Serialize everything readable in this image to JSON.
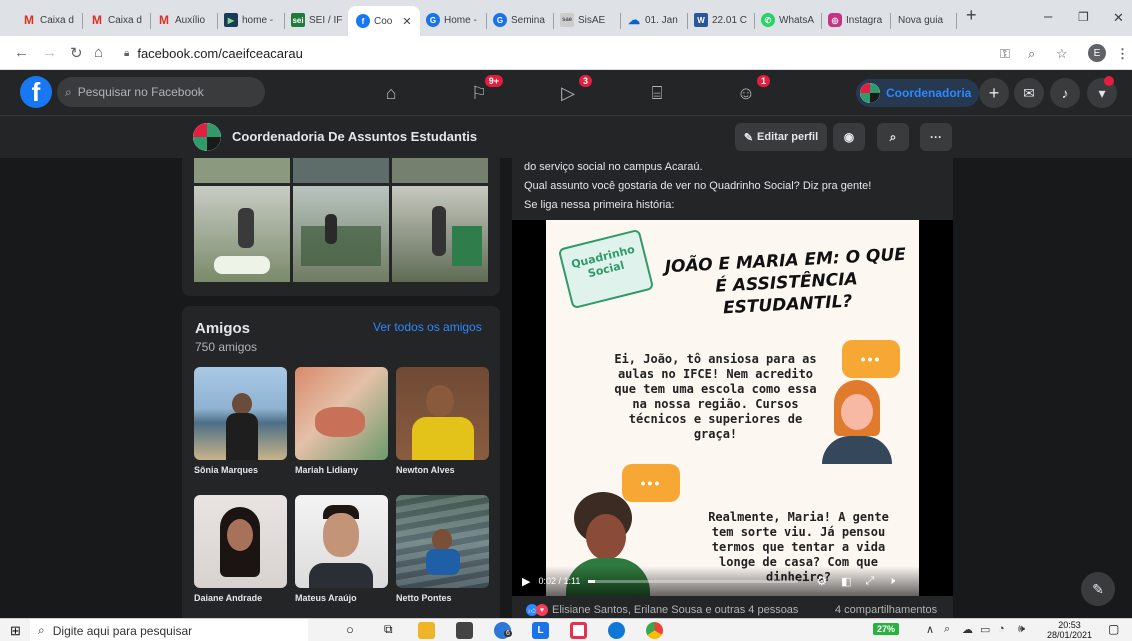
{
  "browser": {
    "tabs": [
      {
        "label": "Caixa d",
        "icon": "gmail-icon"
      },
      {
        "label": "Caixa d",
        "icon": "gmail-icon"
      },
      {
        "label": "Auxílio",
        "icon": "gmail-icon"
      },
      {
        "label": "home -",
        "icon": "video-icon"
      },
      {
        "label": "SEI / IF",
        "icon": "sei-icon"
      },
      {
        "label": "Coo",
        "icon": "facebook-icon"
      },
      {
        "label": "Home -",
        "icon": "google-icon"
      },
      {
        "label": "Semina",
        "icon": "google-icon"
      },
      {
        "label": "SisAE",
        "icon": "sisae-icon"
      },
      {
        "label": "01. Jan",
        "icon": "onedrive-icon"
      },
      {
        "label": "22.01 C",
        "icon": "word-icon"
      },
      {
        "label": "WhatsA",
        "icon": "whatsapp-icon"
      },
      {
        "label": "Instagra",
        "icon": "instagram-icon"
      },
      {
        "label": "Nova guia",
        "icon": ""
      }
    ],
    "url": "facebook.com/caeifceacarau",
    "profile_initial": "E"
  },
  "facebook": {
    "search_placeholder": "Pesquisar no Facebook",
    "badges": {
      "pages": "9+",
      "watch": "3",
      "groups": "1"
    },
    "page_chip": "Coordenadoria",
    "page_name": "Coordenadoria De Assuntos Estudantis",
    "edit_profile": "Editar perfil"
  },
  "friends": {
    "title": "Amigos",
    "count": "750 amigos",
    "see_all": "Ver todos os amigos",
    "list": [
      {
        "name": "Sônia Marques"
      },
      {
        "name": "Mariah Lidiany"
      },
      {
        "name": "Newton Alves"
      },
      {
        "name": "Daiane Andrade"
      },
      {
        "name": "Mateus Araújo"
      },
      {
        "name": "Netto Pontes"
      }
    ]
  },
  "post": {
    "line1": "do serviço social no campus Acaraú.",
    "line2": "Qual assunto você gostaria de ver no Quadrinho Social? Diz pra gente!",
    "line3": "Se liga nessa primeira história:",
    "video": {
      "badge_line1": "Quadrinho",
      "badge_line2": "Social",
      "title": "JOÃO E MARIA EM: O QUE É ASSISTÊNCIA ESTUDANTIL?",
      "bubble1": "Ei, João, tô ansiosa para as aulas no IFCE! Nem acredito que tem uma escola como essa na nossa região. Cursos técnicos e superiores de graça!",
      "bubble2": "Realmente, Maria! A gente tem sorte viu. Já pensou termos que tentar a vida longe de casa? Com que dinheiro?",
      "time": "0:02 / 1:11",
      "progress": 0.03
    },
    "reactions": "Elisiane Santos, Erilane Sousa e outras 4 pessoas",
    "shares": "4 compartilhamentos"
  },
  "taskbar": {
    "search_placeholder": "Digite aqui para pesquisar",
    "battery": "27%",
    "time": "20:53",
    "date": "28/01/2021",
    "edge_badge": "6"
  }
}
